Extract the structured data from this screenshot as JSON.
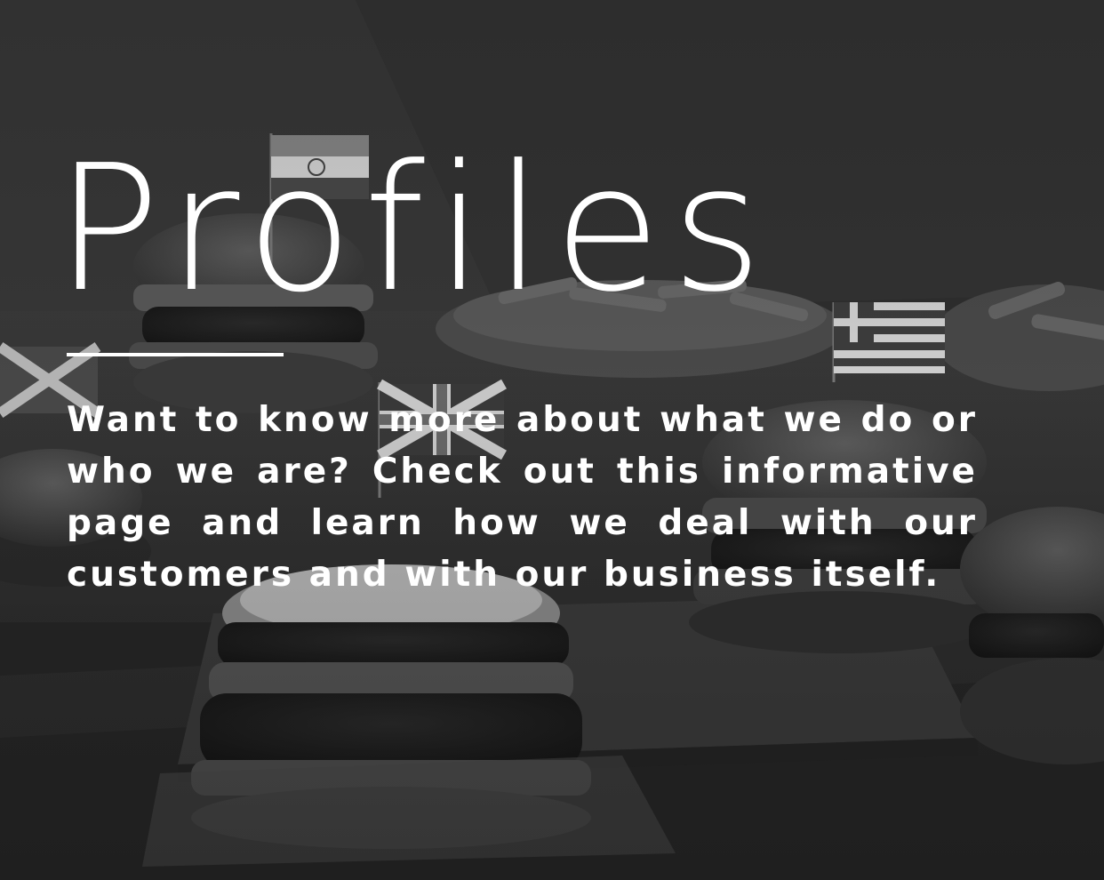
{
  "page": {
    "title": "Profiles",
    "description": "Want to know more about what we do or who we are? Check out this informative page and learn how we deal with our cus­tomers and with our business itself."
  },
  "background": {
    "style": "grayscale-photo",
    "subjects": [
      "burger-stack",
      "fries-bowl",
      "india-flag",
      "uk-flag",
      "greece-flag",
      "jamaica-flag"
    ]
  },
  "colors": {
    "text": "#ffffff",
    "background": "#2f2f2f"
  }
}
